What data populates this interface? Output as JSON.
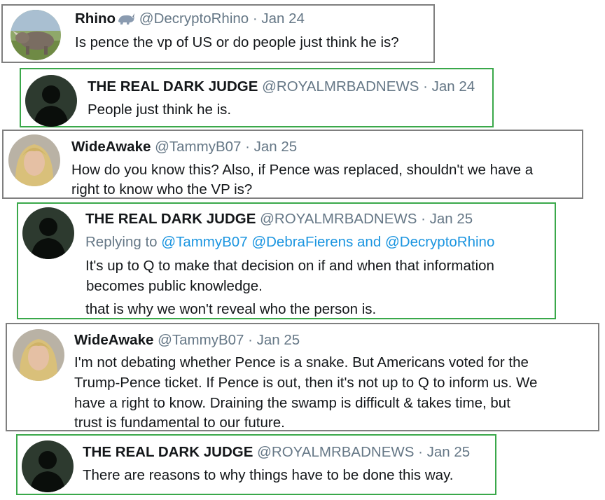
{
  "tweets": [
    {
      "name": "Rhino",
      "handle": "@DecryptoRhino",
      "date": "Jan 24",
      "avatar": "rhino-avatar",
      "text": [
        "Is pence the vp of US or do people just think he is?"
      ]
    },
    {
      "name": "THE REAL DARK JUDGE",
      "handle": "@ROYALMRBADNEWS",
      "date": "Jan 24",
      "avatar": "silhouette-avatar",
      "text": [
        "People just think he is."
      ]
    },
    {
      "name": "WideAwake",
      "handle": "@TammyB07",
      "date": "Jan 25",
      "avatar": "woman-avatar",
      "text": [
        "How do you know this? Also, if Pence was replaced, shouldn't we have a",
        "right to know who the VP is?"
      ]
    },
    {
      "name": "THE REAL DARK JUDGE",
      "handle": "@ROYALMRBADNEWS",
      "date": "Jan 25",
      "avatar": "silhouette-avatar",
      "reply_prefix": "Replying to",
      "reply_mentions": [
        "@TammyB07",
        "@DebraFierens",
        "@DecryptoRhino"
      ],
      "reply_and": "and",
      "text": [
        "It's up to Q to make that decision on if and when that information",
        "becomes public knowledge.",
        "that is why we won't reveal who the person is."
      ]
    },
    {
      "name": "WideAwake",
      "handle": "@TammyB07",
      "date": "Jan 25",
      "avatar": "woman-avatar",
      "text": [
        "I'm not debating whether Pence is a snake. But Americans voted for the",
        "Trump-Pence ticket.  If Pence is out, then it's not up to Q to inform us. We",
        "have a right to know. Draining the swamp is difficult & takes time, but",
        "trust is fundamental to our future."
      ]
    },
    {
      "name": "THE REAL DARK JUDGE",
      "handle": "@ROYALMRBADNEWS",
      "date": "Jan 25",
      "avatar": "silhouette-avatar",
      "text": [
        "There are reasons to why things have to be done this way."
      ]
    }
  ],
  "separator": " · ",
  "icons": {
    "name_emoji": "rhino-emoji-icon"
  },
  "colors": {
    "gray_border": "#7f7f7f",
    "green_border": "#3aa84a",
    "mention": "#1b95e0",
    "meta": "#657786"
  }
}
